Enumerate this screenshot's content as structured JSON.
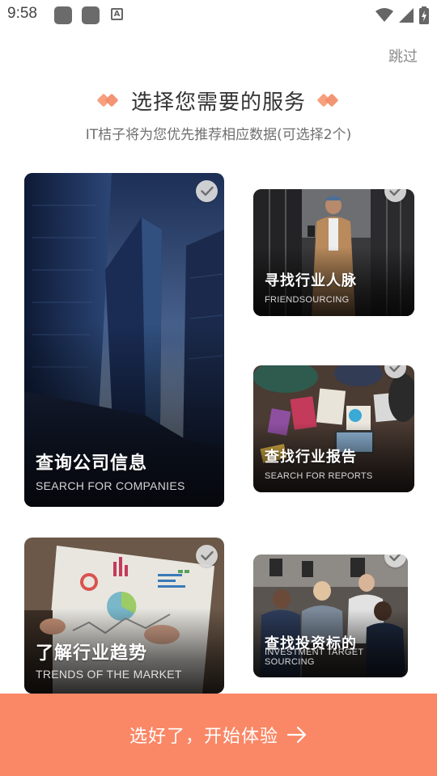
{
  "status_bar": {
    "time": "9:58",
    "icons": [
      "app-notification-icon",
      "app-notification-icon",
      "a-badge-icon",
      "wifi-icon",
      "signal-icon",
      "battery-charging-icon"
    ],
    "a_glyph": "A"
  },
  "header": {
    "skip_label": "跳过",
    "title": "选择您需要的服务",
    "subtitle": "IT桔子将为您优先推荐相应数据(可选择2个)"
  },
  "cards": [
    {
      "id": "companies",
      "title": "查询公司信息",
      "subtitle": "SEARCH FOR COMPANIES",
      "image": "skyscrapers-photo"
    },
    {
      "id": "friends",
      "title": "寻找行业人脉",
      "subtitle": "FRIENDSOURCING",
      "image": "man-with-phone-photo"
    },
    {
      "id": "reports",
      "title": "查找行业报告",
      "subtitle": "SEARCH FOR REPORTS",
      "image": "desk-reports-photo"
    },
    {
      "id": "trends",
      "title": "了解行业趋势",
      "subtitle": "TRENDS OF THE MARKET",
      "image": "charts-paper-photo"
    },
    {
      "id": "investment",
      "title": "查找投资标的",
      "subtitle": "INVESTMENT TARGET SOURCING",
      "image": "team-meeting-photo"
    }
  ],
  "footer": {
    "start_label": "选好了，开始体验",
    "arrow_icon": "arrow-right-icon"
  },
  "colors": {
    "accent": "#fa8766",
    "diamond": "#f28a66",
    "check_bg": "#dcdcdc"
  }
}
